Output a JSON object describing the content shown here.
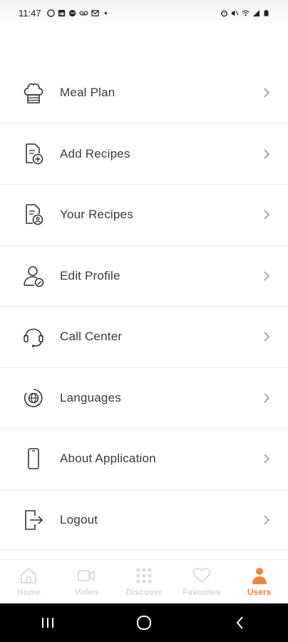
{
  "status_bar": {
    "time": "11:47",
    "left_icons": [
      "github-icon",
      "linkedin-icon",
      "messenger-icon",
      "voicemail-icon",
      "gmail-icon",
      "dot-icon"
    ],
    "right_icons": [
      "alarm-icon",
      "mute-icon",
      "wifi-icon",
      "signal-icon",
      "battery-icon"
    ]
  },
  "menu": {
    "items": [
      {
        "label": "Meal Plan",
        "icon": "chef-hat-icon"
      },
      {
        "label": "Add Recipes",
        "icon": "add-document-icon"
      },
      {
        "label": "Your Recipes",
        "icon": "user-document-icon"
      },
      {
        "label": "Edit Profile",
        "icon": "edit-profile-icon"
      },
      {
        "label": "Call Center",
        "icon": "headset-icon"
      },
      {
        "label": "Languages",
        "icon": "globe-icon"
      },
      {
        "label": "About Application",
        "icon": "phone-icon"
      },
      {
        "label": "Logout",
        "icon": "logout-icon"
      }
    ]
  },
  "tabbar": {
    "tabs": [
      {
        "label": "Home",
        "icon": "home-icon",
        "active": false
      },
      {
        "label": "Video",
        "icon": "video-icon",
        "active": false
      },
      {
        "label": "Discover",
        "icon": "grid-icon",
        "active": false
      },
      {
        "label": "Favorites",
        "icon": "heart-icon",
        "active": false
      },
      {
        "label": "Users",
        "icon": "user-icon",
        "active": true
      }
    ],
    "active_color": "#f0853a",
    "inactive_color": "#d9d9d9"
  },
  "system_nav": {
    "buttons": [
      "recents-icon",
      "home-circle-icon",
      "back-icon"
    ]
  }
}
